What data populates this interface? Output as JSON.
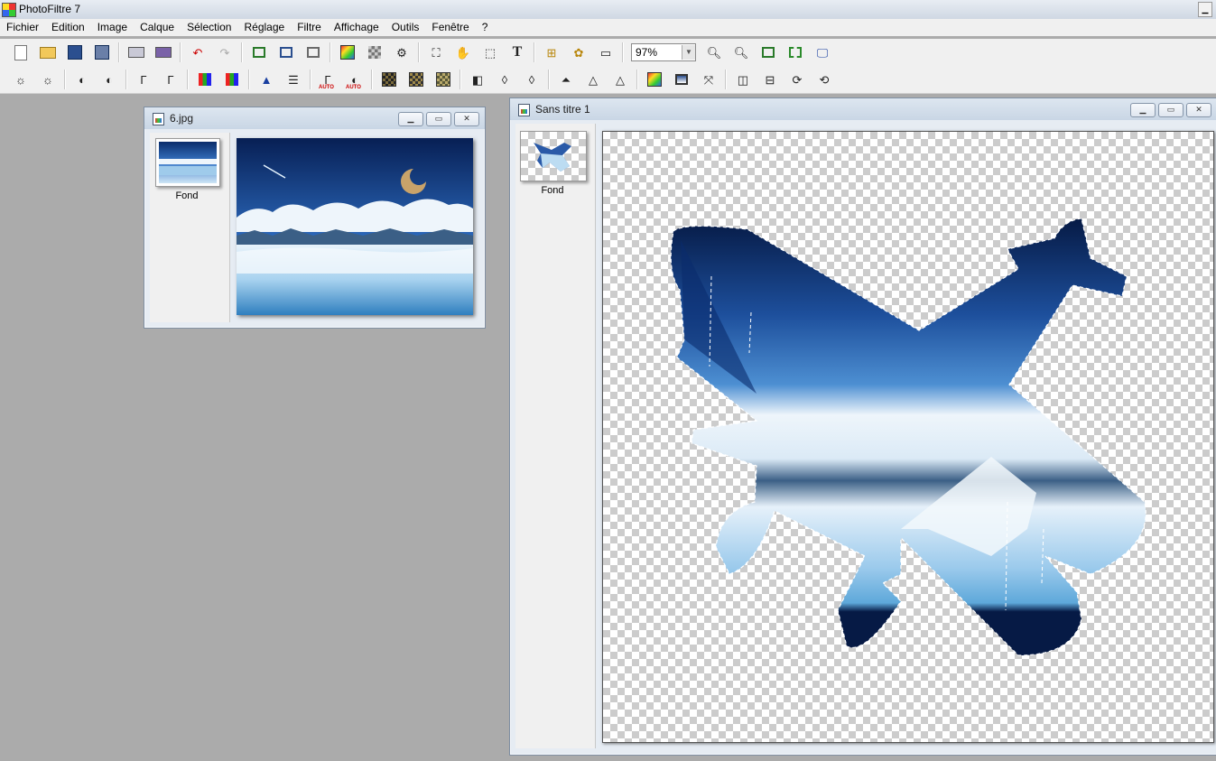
{
  "app": {
    "title": "PhotoFiltre 7"
  },
  "menu": [
    "Fichier",
    "Edition",
    "Image",
    "Calque",
    "Sélection",
    "Réglage",
    "Filtre",
    "Affichage",
    "Outils",
    "Fenêtre",
    "?"
  ],
  "toolbar": {
    "zoom": "97%"
  },
  "windows": {
    "source": {
      "title": "6.jpg",
      "layer_label": "Fond"
    },
    "target": {
      "title": "Sans titre 1",
      "layer_label": "Fond"
    }
  },
  "colors": {
    "workspace": "#ababab",
    "sky_dark": "#0b2d6b",
    "sky_mid": "#2a66b8",
    "cloud": "#eef5fb",
    "mountain": "#3b5f86",
    "water": "#5ea8da"
  }
}
